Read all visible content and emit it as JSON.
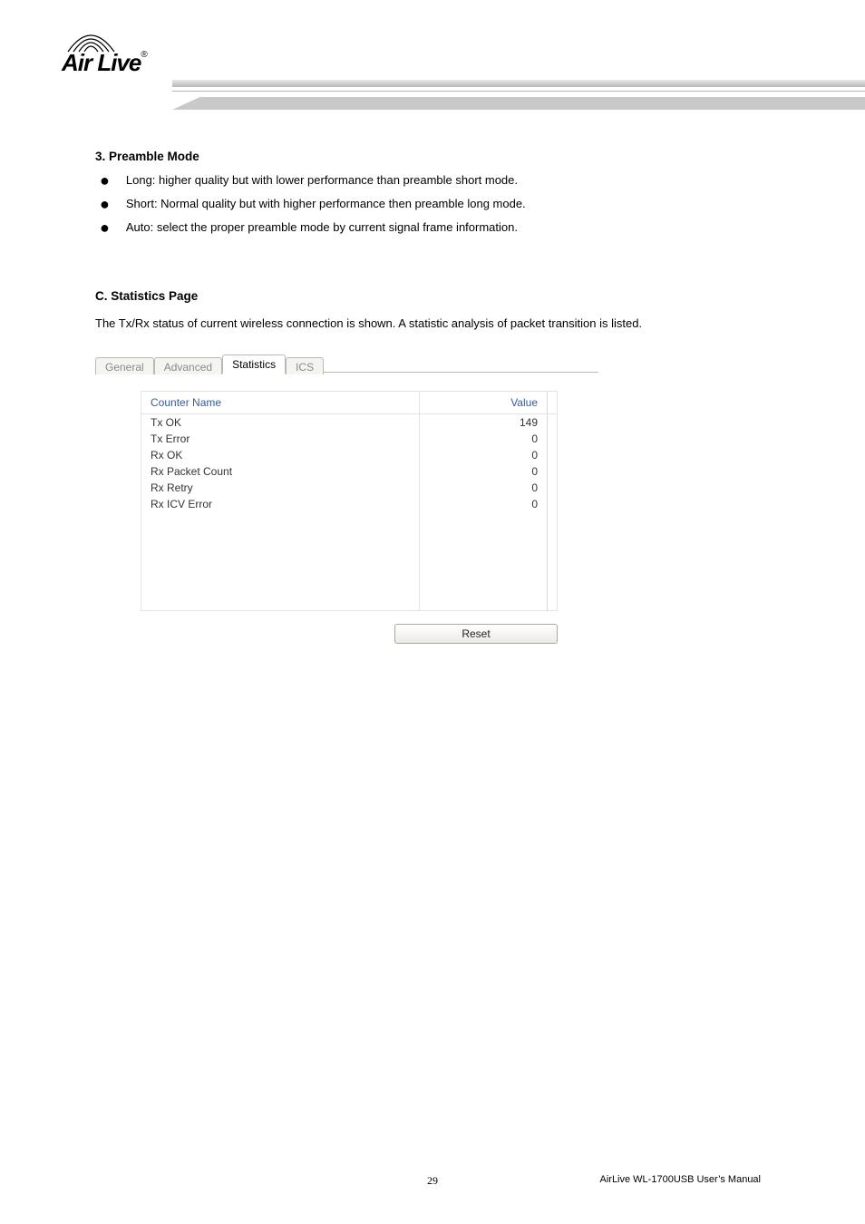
{
  "logo": {
    "brand": "Air Live",
    "reg": "®"
  },
  "section1": {
    "title": "3. Preamble Mode",
    "bullets": [
      "Long: higher quality but with lower performance than preamble short mode.",
      "Short: Normal quality but with higher performance then preamble long mode.",
      "Auto: select the proper preamble mode by current signal frame information."
    ]
  },
  "section2": {
    "title": "C. Statistics Page",
    "paragraph": "The Tx/Rx status of current wireless connection is shown. A statistic analysis of packet transition is listed."
  },
  "tabs": {
    "general": "General",
    "advanced": "Advanced",
    "statistics": "Statistics",
    "ics": "ICS"
  },
  "table": {
    "head_name": "Counter Name",
    "head_value": "Value",
    "rows": [
      {
        "name": "Tx OK",
        "value": "149"
      },
      {
        "name": "Tx Error",
        "value": "0"
      },
      {
        "name": "Rx OK",
        "value": "0"
      },
      {
        "name": "Rx Packet Count",
        "value": "0"
      },
      {
        "name": "Rx Retry",
        "value": "0"
      },
      {
        "name": "Rx ICV Error",
        "value": "0"
      }
    ]
  },
  "reset_label": "Reset",
  "footer": {
    "page": "29",
    "manual": "AirLive WL-1700USB User’s Manual"
  }
}
